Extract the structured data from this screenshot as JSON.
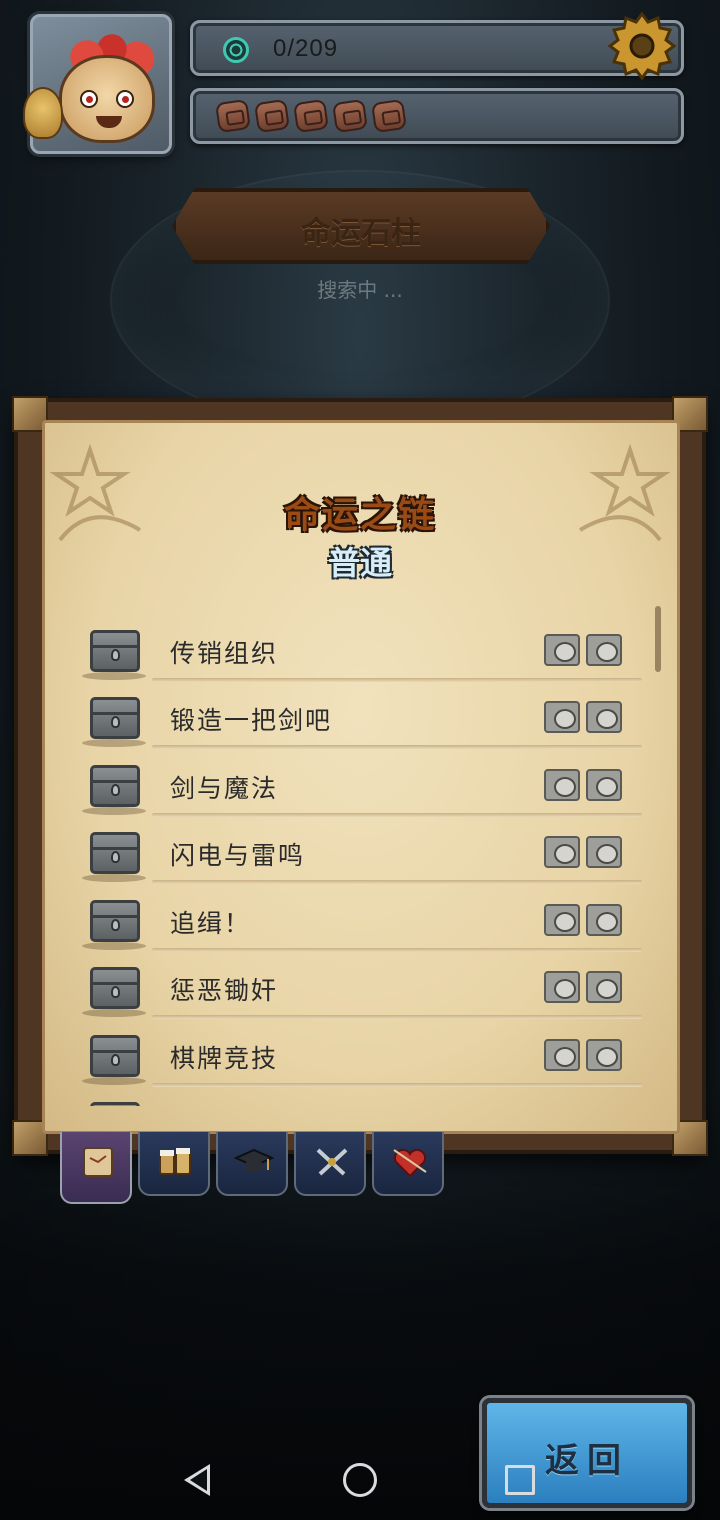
{
  "header": {
    "progress": "0/209",
    "token_count": 5
  },
  "plaque": {
    "title": "命运石柱",
    "status": "搜索中 ..."
  },
  "panel": {
    "title": "命运之链",
    "subtitle": "普通",
    "items": [
      {
        "label": "传销组织"
      },
      {
        "label": "锻造一把剑吧"
      },
      {
        "label": "剑与魔法"
      },
      {
        "label": "闪电与雷鸣"
      },
      {
        "label": "追缉！"
      },
      {
        "label": "惩恶锄奸"
      },
      {
        "label": "棋牌竞技"
      }
    ]
  },
  "tabs": [
    {
      "icon": "map-icon",
      "active": true
    },
    {
      "icon": "beer-mugs-icon",
      "active": false
    },
    {
      "icon": "graduation-cap-icon",
      "active": false
    },
    {
      "icon": "crossed-swords-icon",
      "active": false
    },
    {
      "icon": "heart-arrow-icon",
      "active": false
    }
  ],
  "buttons": {
    "return_label": "返回"
  },
  "colors": {
    "panel_title": "#9a4a14",
    "panel_subtitle": "#d7eef8",
    "return_button": "#2b7fbf",
    "progress_icon": "#3fc9b4"
  }
}
